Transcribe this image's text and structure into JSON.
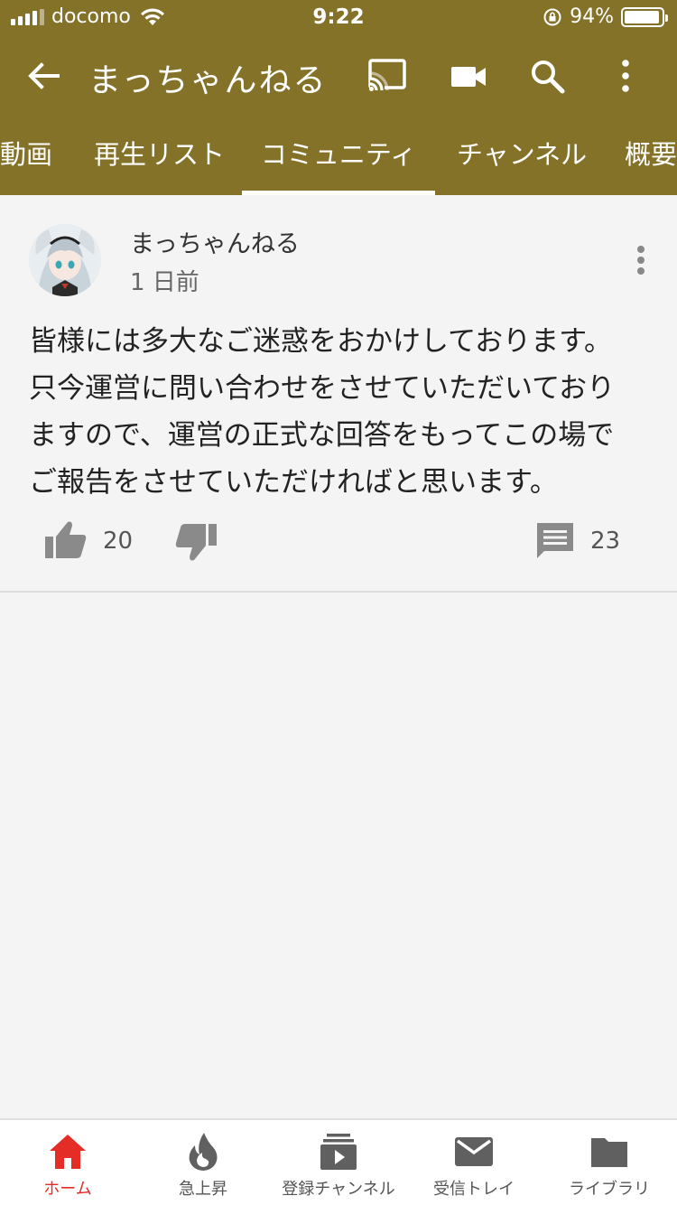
{
  "status_bar": {
    "carrier": "docomo",
    "time": "9:22",
    "battery_percent": "94%",
    "battery_level": 0.94
  },
  "app_bar": {
    "title": "まっちゃんねる",
    "icons": [
      "back-arrow-icon",
      "cast-icon",
      "video-camera-icon",
      "search-icon",
      "more-vert-icon"
    ]
  },
  "tabs": [
    {
      "label": "動画",
      "active": false
    },
    {
      "label": "再生リスト",
      "active": false
    },
    {
      "label": "コミュニティ",
      "active": true
    },
    {
      "label": "チャンネル",
      "active": false
    },
    {
      "label": "概要",
      "active": false
    }
  ],
  "post": {
    "author": "まっちゃんねる",
    "time": "1 日前",
    "body_lines": [
      "皆様には多大なご迷惑をおかけしております。",
      "只今運営に問い合わせをさせていただいており",
      "ますので、運営の正式な回答をもってこの場で",
      "ご報告をさせていただければと思います。"
    ],
    "likes": "20",
    "comments": "23"
  },
  "bottom_nav": [
    {
      "label": "ホーム",
      "icon": "home-icon",
      "active": true
    },
    {
      "label": "急上昇",
      "icon": "flame-icon",
      "active": false
    },
    {
      "label": "登録チャンネル",
      "icon": "subscriptions-icon",
      "active": false
    },
    {
      "label": "受信トレイ",
      "icon": "mail-icon",
      "active": false
    },
    {
      "label": "ライブラリ",
      "icon": "folder-icon",
      "active": false
    }
  ],
  "colors": {
    "header": "#857229",
    "active_nav": "#e52d27",
    "background": "#f4f4f4"
  }
}
